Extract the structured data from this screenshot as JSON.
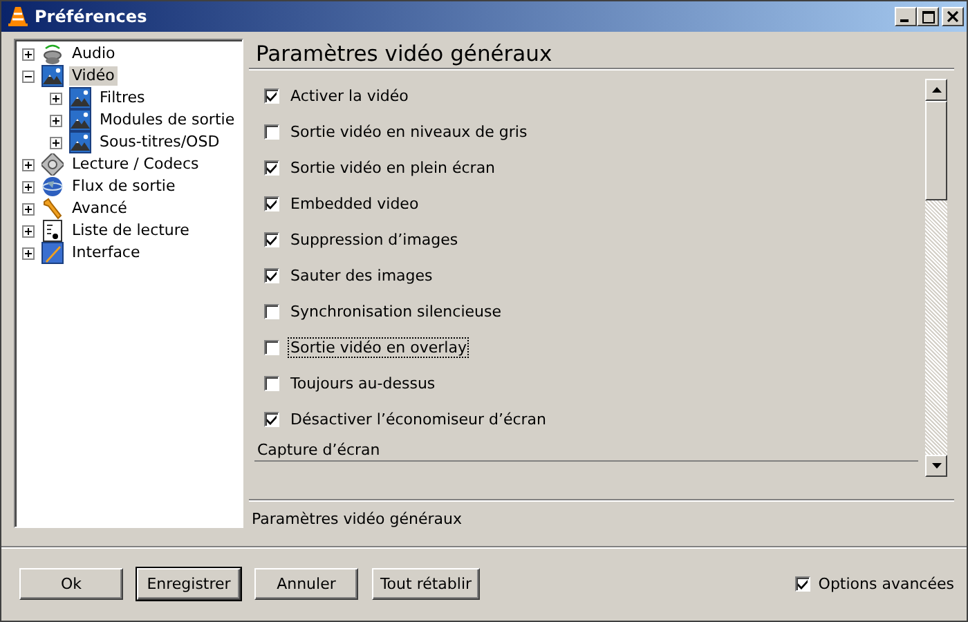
{
  "window": {
    "title": "Préférences"
  },
  "tree": [
    {
      "label": "Audio",
      "expanded": false,
      "selected": false
    },
    {
      "label": "Vidéo",
      "expanded": true,
      "selected": true,
      "children": [
        {
          "label": "Filtres",
          "expanded": false,
          "selected": false
        },
        {
          "label": "Modules de sortie",
          "expanded": false,
          "selected": false
        },
        {
          "label": "Sous-titres/OSD",
          "expanded": false,
          "selected": false
        }
      ]
    },
    {
      "label": "Lecture / Codecs",
      "expanded": false,
      "selected": false
    },
    {
      "label": "Flux de sortie",
      "expanded": false,
      "selected": false
    },
    {
      "label": "Avancé",
      "expanded": false,
      "selected": false
    },
    {
      "label": "Liste de lecture",
      "expanded": false,
      "selected": false
    },
    {
      "label": "Interface",
      "expanded": false,
      "selected": false
    }
  ],
  "panel": {
    "title": "Paramètres vidéo généraux",
    "options": [
      {
        "label": "Activer la vidéo",
        "checked": true,
        "focused": false
      },
      {
        "label": "Sortie vidéo en niveaux de gris",
        "checked": false,
        "focused": false
      },
      {
        "label": "Sortie vidéo en plein écran",
        "checked": true,
        "focused": false
      },
      {
        "label": "Embedded video",
        "checked": true,
        "focused": false
      },
      {
        "label": "Suppression d’images",
        "checked": true,
        "focused": false
      },
      {
        "label": "Sauter des images",
        "checked": true,
        "focused": false
      },
      {
        "label": "Synchronisation silencieuse",
        "checked": false,
        "focused": false
      },
      {
        "label": "Sortie vidéo en overlay",
        "checked": false,
        "focused": true
      },
      {
        "label": "Toujours au-dessus",
        "checked": false,
        "focused": false
      },
      {
        "label": "Désactiver l’économiseur d’écran",
        "checked": true,
        "focused": false
      }
    ],
    "section": "Capture d’écran",
    "description": "Paramètres vidéo généraux"
  },
  "buttons": [
    {
      "label": "Ok",
      "default": false
    },
    {
      "label": "Enregistrer",
      "default": true
    },
    {
      "label": "Annuler",
      "default": false
    },
    {
      "label": "Tout rétablir",
      "default": false
    }
  ],
  "advanced": {
    "label": "Options avancées",
    "checked": true
  }
}
